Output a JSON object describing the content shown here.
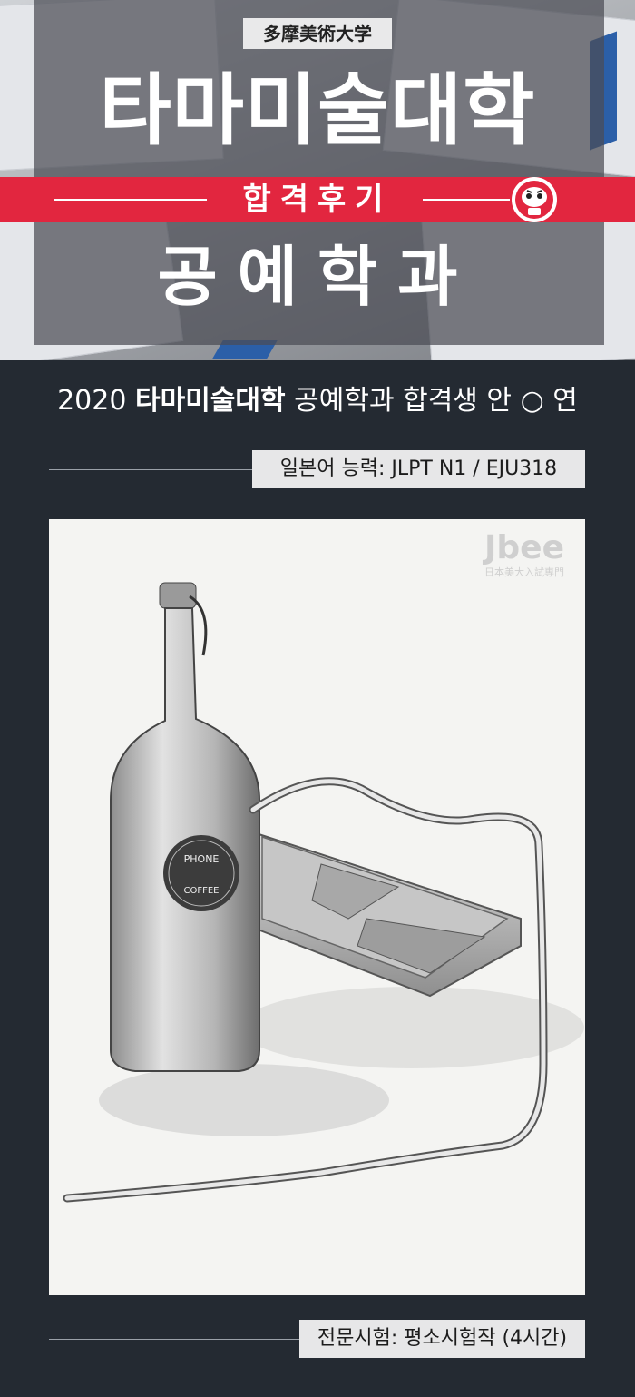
{
  "header": {
    "university_jp": "多摩美術大学",
    "university_ko": "타마미술대학",
    "band_text": "합격후기",
    "department": "공예학과"
  },
  "info": {
    "headline_year": "2020",
    "headline_school": "타마미술대학",
    "headline_rest": "공예학과 합격생 안 ○ 연",
    "language_tag": "일본어 능력: JLPT N1 / EJU318",
    "exam_tag": "전문시험: 평소시험작 (4시간)"
  },
  "drawing": {
    "logo_main": "Jbee",
    "logo_sub": "日本美大入試専門",
    "bottle_label_top": "PHONE",
    "bottle_label_bottom": "COFFEE"
  },
  "colors": {
    "background": "#242a32",
    "accent_red": "#e2263f",
    "overlay": "#4b4c54",
    "tag_bg": "#e7e7e8"
  }
}
